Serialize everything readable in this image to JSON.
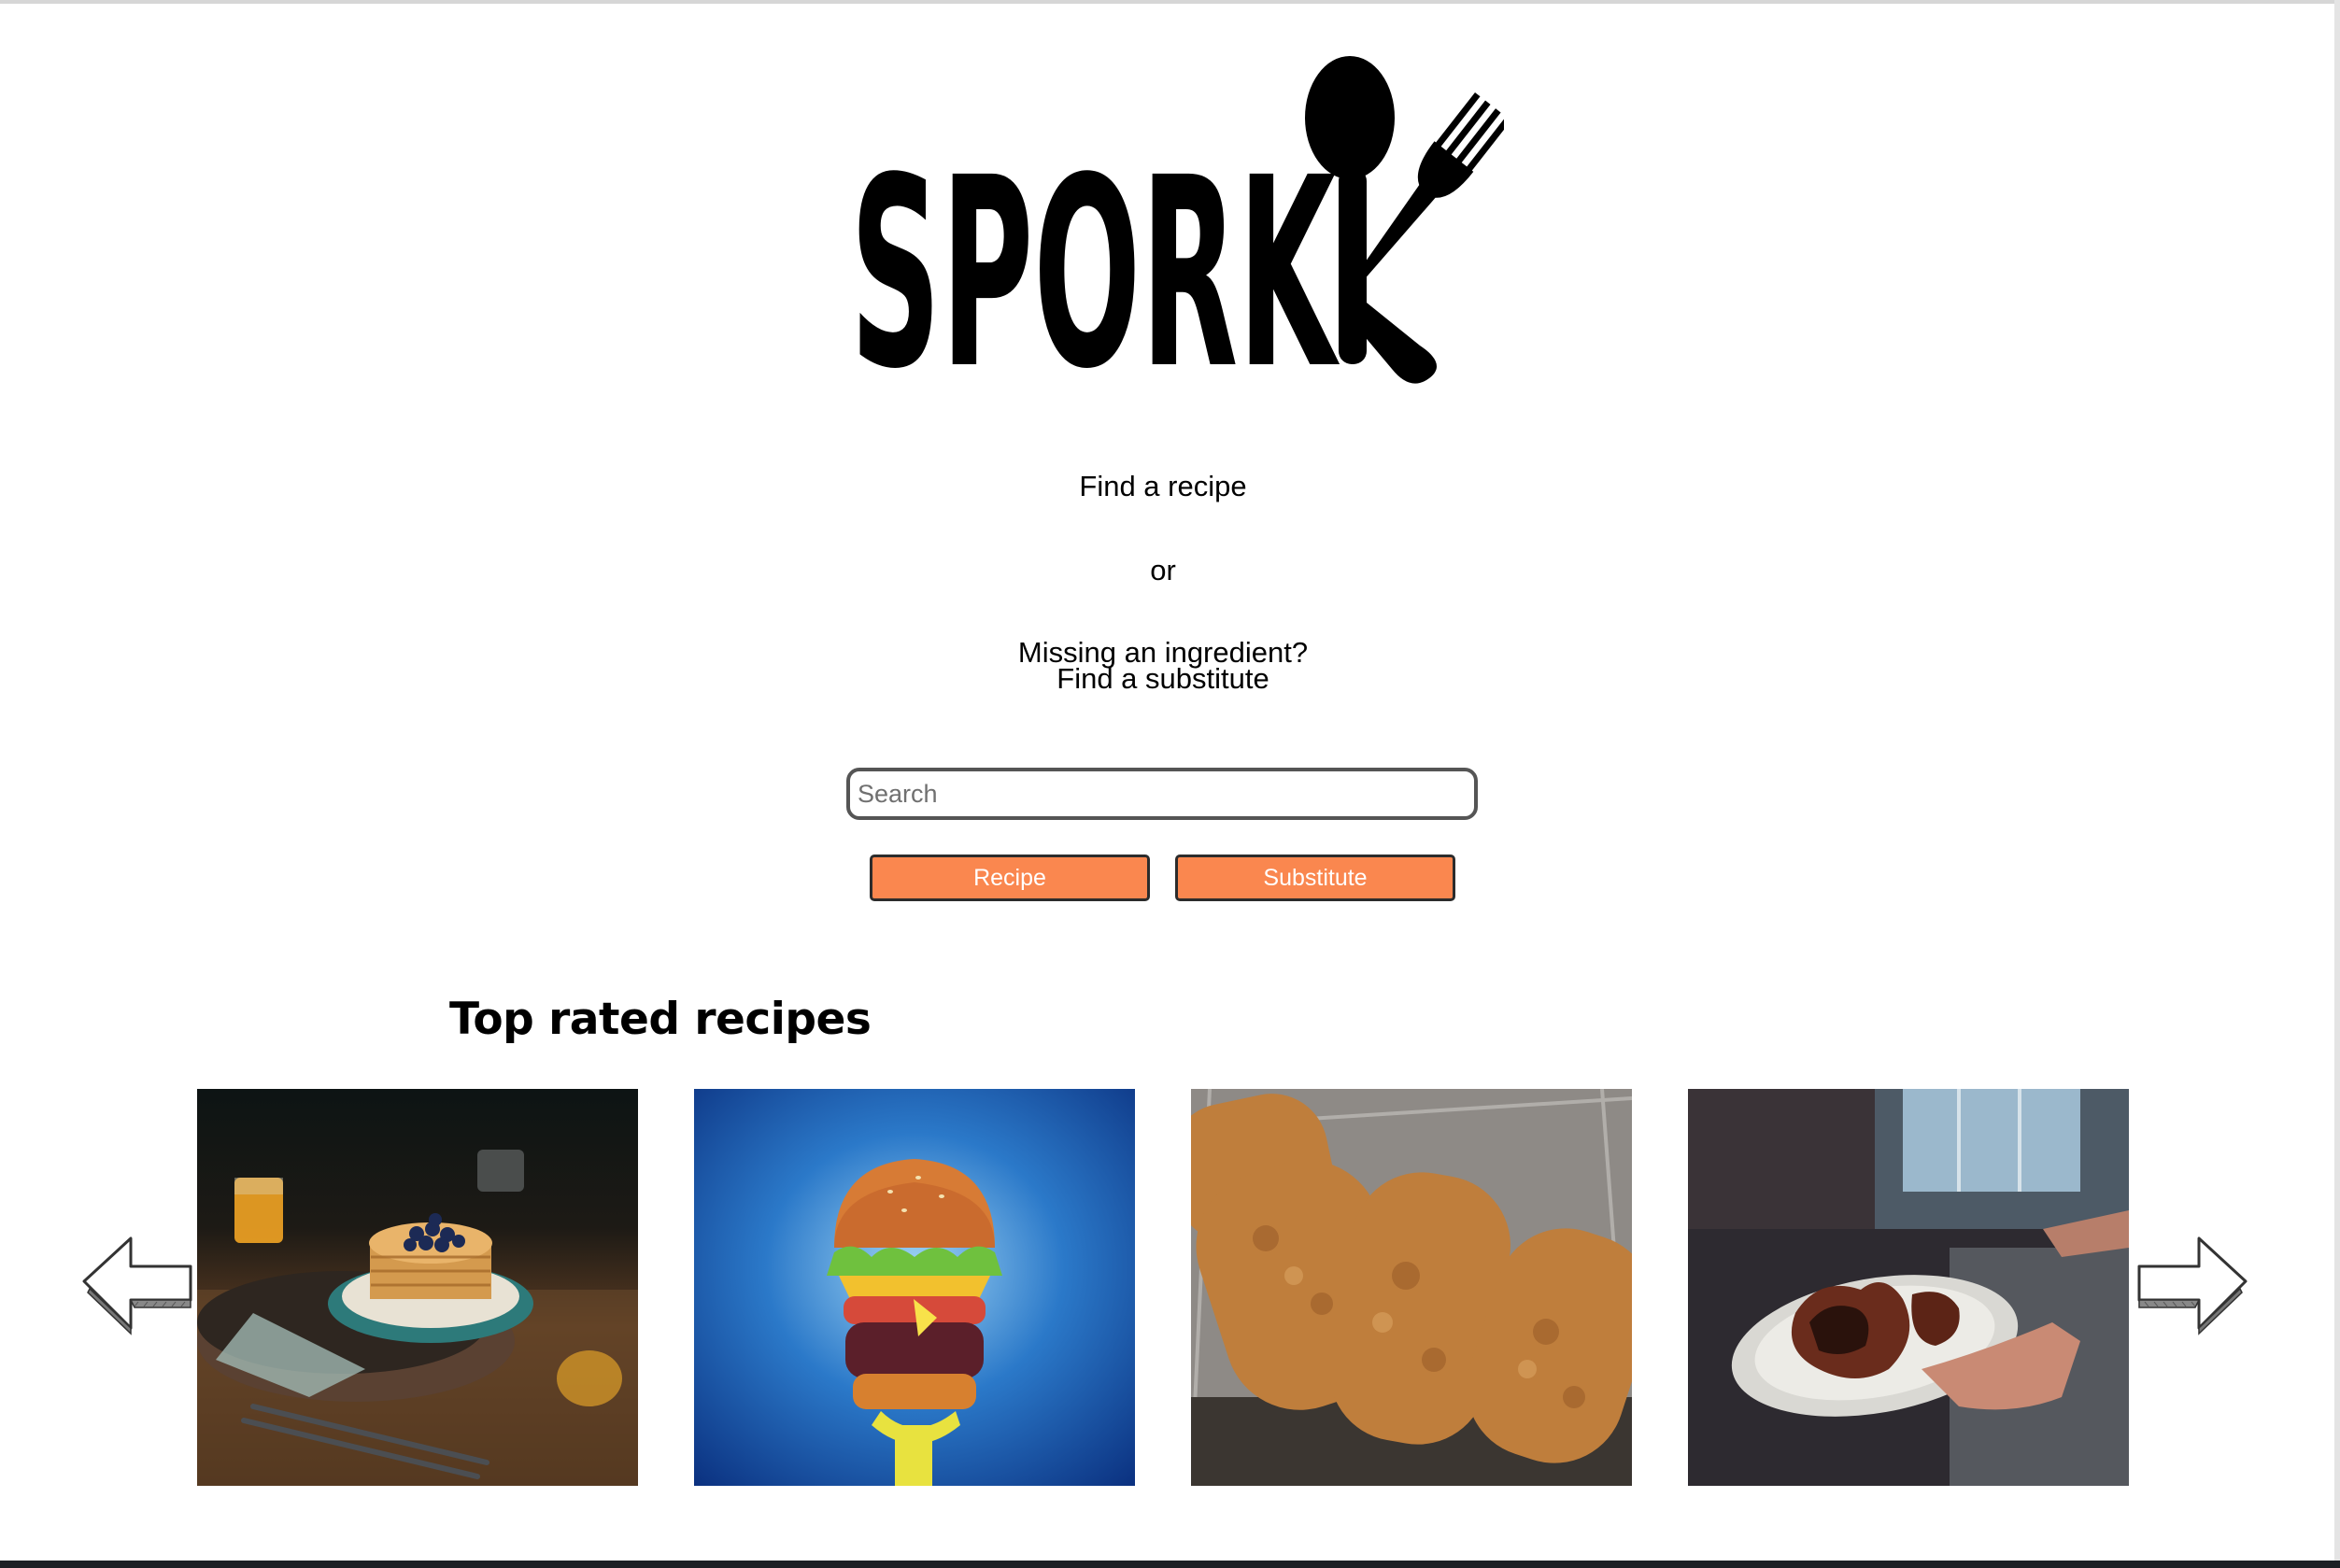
{
  "brand": {
    "logo_text": "SPORK"
  },
  "hero": {
    "find_recipe": "Find a recipe",
    "or": "or",
    "missing_ingredient": "Missing an ingredient?",
    "find_substitute": "Find a substitute"
  },
  "search": {
    "placeholder": "Search",
    "value": ""
  },
  "buttons": {
    "recipe": "Recipe",
    "substitute": "Substitute"
  },
  "top_rated": {
    "title": "Top rated recipes",
    "recipes": [
      {
        "image": "pancakes-photo"
      },
      {
        "image": "krabby-patty-burger-image"
      },
      {
        "image": "breaded-cutlets-photo"
      },
      {
        "image": "grilled-chicken-plate-photo"
      }
    ]
  },
  "carousel": {
    "prev_icon": "left-arrow-icon",
    "next_icon": "right-arrow-icon"
  },
  "colors": {
    "button_bg": "#fa874f",
    "button_text": "#ffffff",
    "button_border": "#2c2c2c"
  }
}
